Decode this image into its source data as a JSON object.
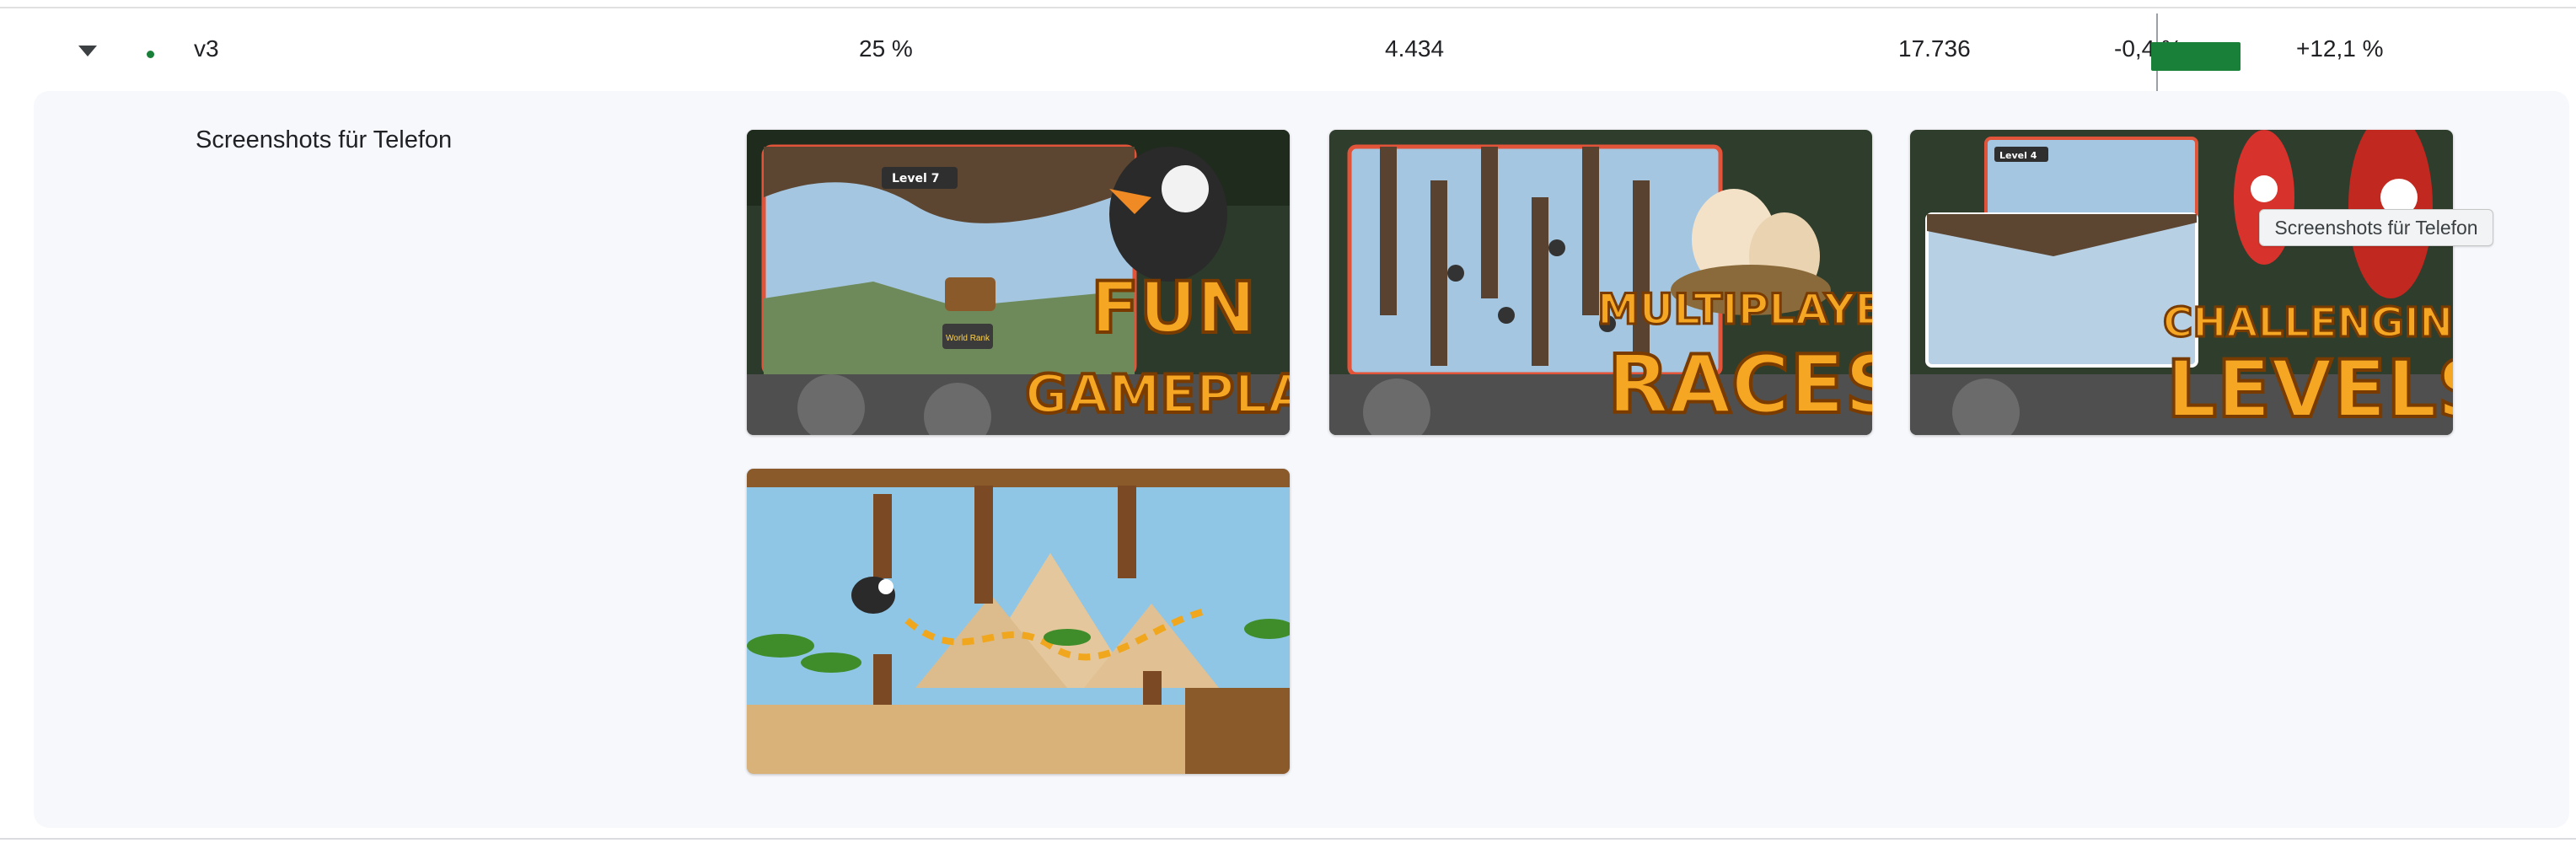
{
  "row": {
    "variant": "v3",
    "audience": "25 %",
    "installers": "4.434",
    "scaled_installers": "17.736",
    "ci_low": "-0,4 %",
    "ci_high": "+12,1 %",
    "ci_range_percent": [
      -0.4,
      12.1
    ],
    "ci_color": "#188038",
    "status_dot_color": "#188038"
  },
  "panel": {
    "label": "Screenshots für Telefon",
    "screenshots": [
      {
        "caption_top": "FUN",
        "caption_bottom": "GAMEPLAY",
        "hud_level": "Level 7",
        "hud_rank": "World Rank"
      },
      {
        "caption_top": "MULTIPLAYER",
        "caption_bottom": "RACES"
      },
      {
        "caption_top": "CHALLENGING",
        "caption_bottom": "LEVELS",
        "hud_level": "Level 4"
      },
      {
        "caption_top": "",
        "caption_bottom": ""
      }
    ]
  },
  "tooltip": {
    "text": "Screenshots für Telefon"
  },
  "icons": {
    "expand": "chevron-down-icon",
    "status": "status-dot-icon"
  }
}
